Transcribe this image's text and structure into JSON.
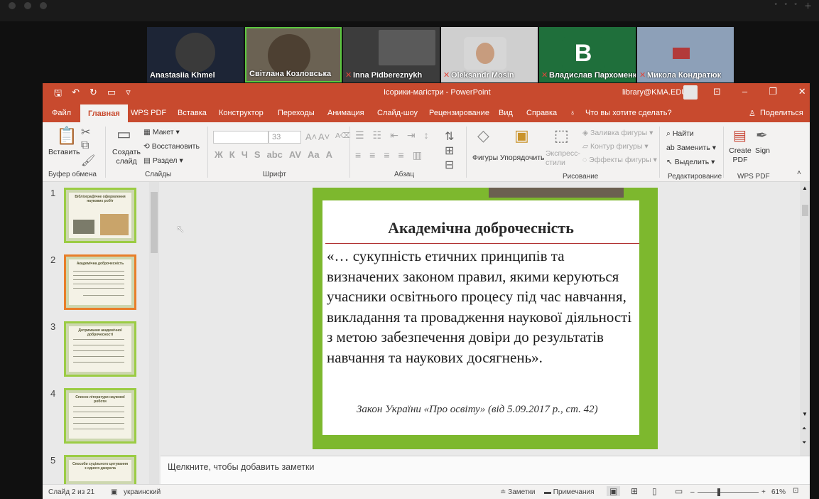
{
  "participants": [
    {
      "name": "Anastasiia Khmel",
      "muted": false,
      "type": "video",
      "bg": "#1d2536"
    },
    {
      "name": "Світлана Козловська",
      "muted": false,
      "type": "video",
      "bg": "#6b6253",
      "active": true
    },
    {
      "name": "Inna Pidbereznykh",
      "muted": true,
      "type": "video",
      "bg": "#3c3c3c"
    },
    {
      "name": "Oleksandr Mosin",
      "muted": true,
      "type": "photo",
      "bg": "#cfcfcf"
    },
    {
      "name": "Владислав Пархоменко",
      "muted": true,
      "type": "letter",
      "letter": "B",
      "bg": "#1f6f3b"
    },
    {
      "name": "Микола Кондратюк",
      "muted": true,
      "type": "photo",
      "bg": "#8da0b8"
    }
  ],
  "titlebar": {
    "doc": "Ісорики-магістри  -  PowerPoint",
    "account": "library@KMA.EDU"
  },
  "tabs": [
    "Файл",
    "Главная",
    "WPS PDF",
    "Вставка",
    "Конструктор",
    "Переходы",
    "Анимация",
    "Слайд-шоу",
    "Рецензирование",
    "Вид",
    "Справка"
  ],
  "selected_tab": "Главная",
  "tell_me": "Что вы хотите сделать?",
  "share": "Поделиться",
  "ribbon": {
    "paste": "Вставить",
    "clipboard": "Буфер обмена",
    "new_slide": "Создать слайд",
    "layout": "Макет",
    "reset": "Восстановить",
    "section": "Раздел",
    "slides": "Слайды",
    "font_size": "33",
    "format_buttons": [
      "Ж",
      "К",
      "Ч",
      "S",
      "abc",
      "AV",
      "Aa"
    ],
    "font": "Шрифт",
    "paragraph": "Абзац",
    "shapes": "Фигуры",
    "arrange": "Упорядочить",
    "quick_styles": "Экспресс-стили",
    "fill": "Заливка фигуры",
    "outline": "Контур фигуры",
    "effects": "Эффекты фигуры",
    "drawing": "Рисование",
    "find": "Найти",
    "replace": "Заменить",
    "select": "Выделить",
    "editing": "Редактирование",
    "create_pdf": "Create PDF",
    "sign": "Sign",
    "wps": "WPS PDF"
  },
  "thumbnails": [
    {
      "num": "1",
      "title": "Бібліографічне оформлення наукових робіт"
    },
    {
      "num": "2",
      "title": "Академічна доброчесність",
      "selected": true
    },
    {
      "num": "3",
      "title": "Дотримання академічної доброчесності"
    },
    {
      "num": "4",
      "title": "Список літератури наукової роботи"
    },
    {
      "num": "5",
      "title": "Способи суцільного цитування з одного джерела"
    }
  ],
  "slide": {
    "title": "Академічна доброчесність",
    "body": "«… сукупність етичних принципів та визначених законом правил, якими керуються учасники освітнього процесу під час навчання, викладання та провадження наукової діяльності з метою забезпечення довіри до результатів навчання та наукових досягнень».",
    "source": "Закон України «Про освіту» (від 5.09.2017 р., ст. 42)"
  },
  "notes_placeholder": "Щелкните, чтобы добавить заметки",
  "status": {
    "slide": "Слайд 2 из 21",
    "language": "украинский",
    "notes": "Заметки",
    "comments": "Примечания",
    "zoom": "61%"
  }
}
